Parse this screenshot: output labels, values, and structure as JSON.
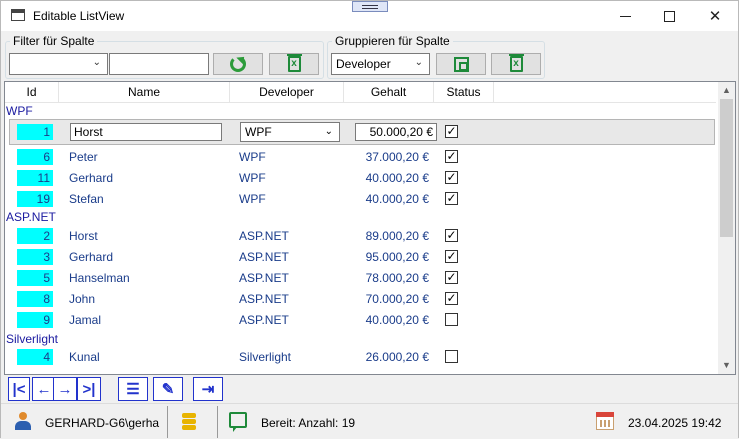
{
  "window": {
    "title": "Editable ListView"
  },
  "filter": {
    "legend": "Filter für Spalte",
    "column_value": "",
    "text_value": ""
  },
  "grouping": {
    "legend": "Gruppieren für Spalte",
    "column_value": "Developer"
  },
  "columns": [
    "Id",
    "Name",
    "Developer",
    "Gehalt",
    "Status"
  ],
  "groups": [
    {
      "name": "WPF",
      "rows": [
        {
          "id": "1",
          "name": "Horst",
          "developer": "WPF",
          "gehalt": "50.000,20 €",
          "status": "✓",
          "editing": true
        },
        {
          "id": "6",
          "name": "Peter",
          "developer": "WPF",
          "gehalt": "37.000,20 €",
          "status": "✓"
        },
        {
          "id": "11",
          "name": "Gerhard",
          "developer": "WPF",
          "gehalt": "40.000,20 €",
          "status": "✓"
        },
        {
          "id": "19",
          "name": "Stefan",
          "developer": "WPF",
          "gehalt": "40.000,20 €",
          "status": "✓"
        }
      ]
    },
    {
      "name": "ASP.NET",
      "rows": [
        {
          "id": "2",
          "name": "Horst",
          "developer": "ASP.NET",
          "gehalt": "89.000,20 €",
          "status": "✓"
        },
        {
          "id": "3",
          "name": "Gerhard",
          "developer": "ASP.NET",
          "gehalt": "95.000,20 €",
          "status": "✓"
        },
        {
          "id": "5",
          "name": "Hanselman",
          "developer": "ASP.NET",
          "gehalt": "78.000,20 €",
          "status": "✓"
        },
        {
          "id": "8",
          "name": "John",
          "developer": "ASP.NET",
          "gehalt": "70.000,20 €",
          "status": "✓"
        },
        {
          "id": "9",
          "name": "Jamal",
          "developer": "ASP.NET",
          "gehalt": "40.000,20 €",
          "status": ""
        }
      ]
    },
    {
      "name": "Silverlight",
      "rows": [
        {
          "id": "4",
          "name": "Kunal",
          "developer": "Silverlight",
          "gehalt": "26.000,20 €",
          "status": ""
        }
      ]
    }
  ],
  "statusbar": {
    "user": "GERHARD-G6\\gerha",
    "status": "Bereit: Anzahl: 19",
    "datetime": "23.04.2025 19:42"
  }
}
